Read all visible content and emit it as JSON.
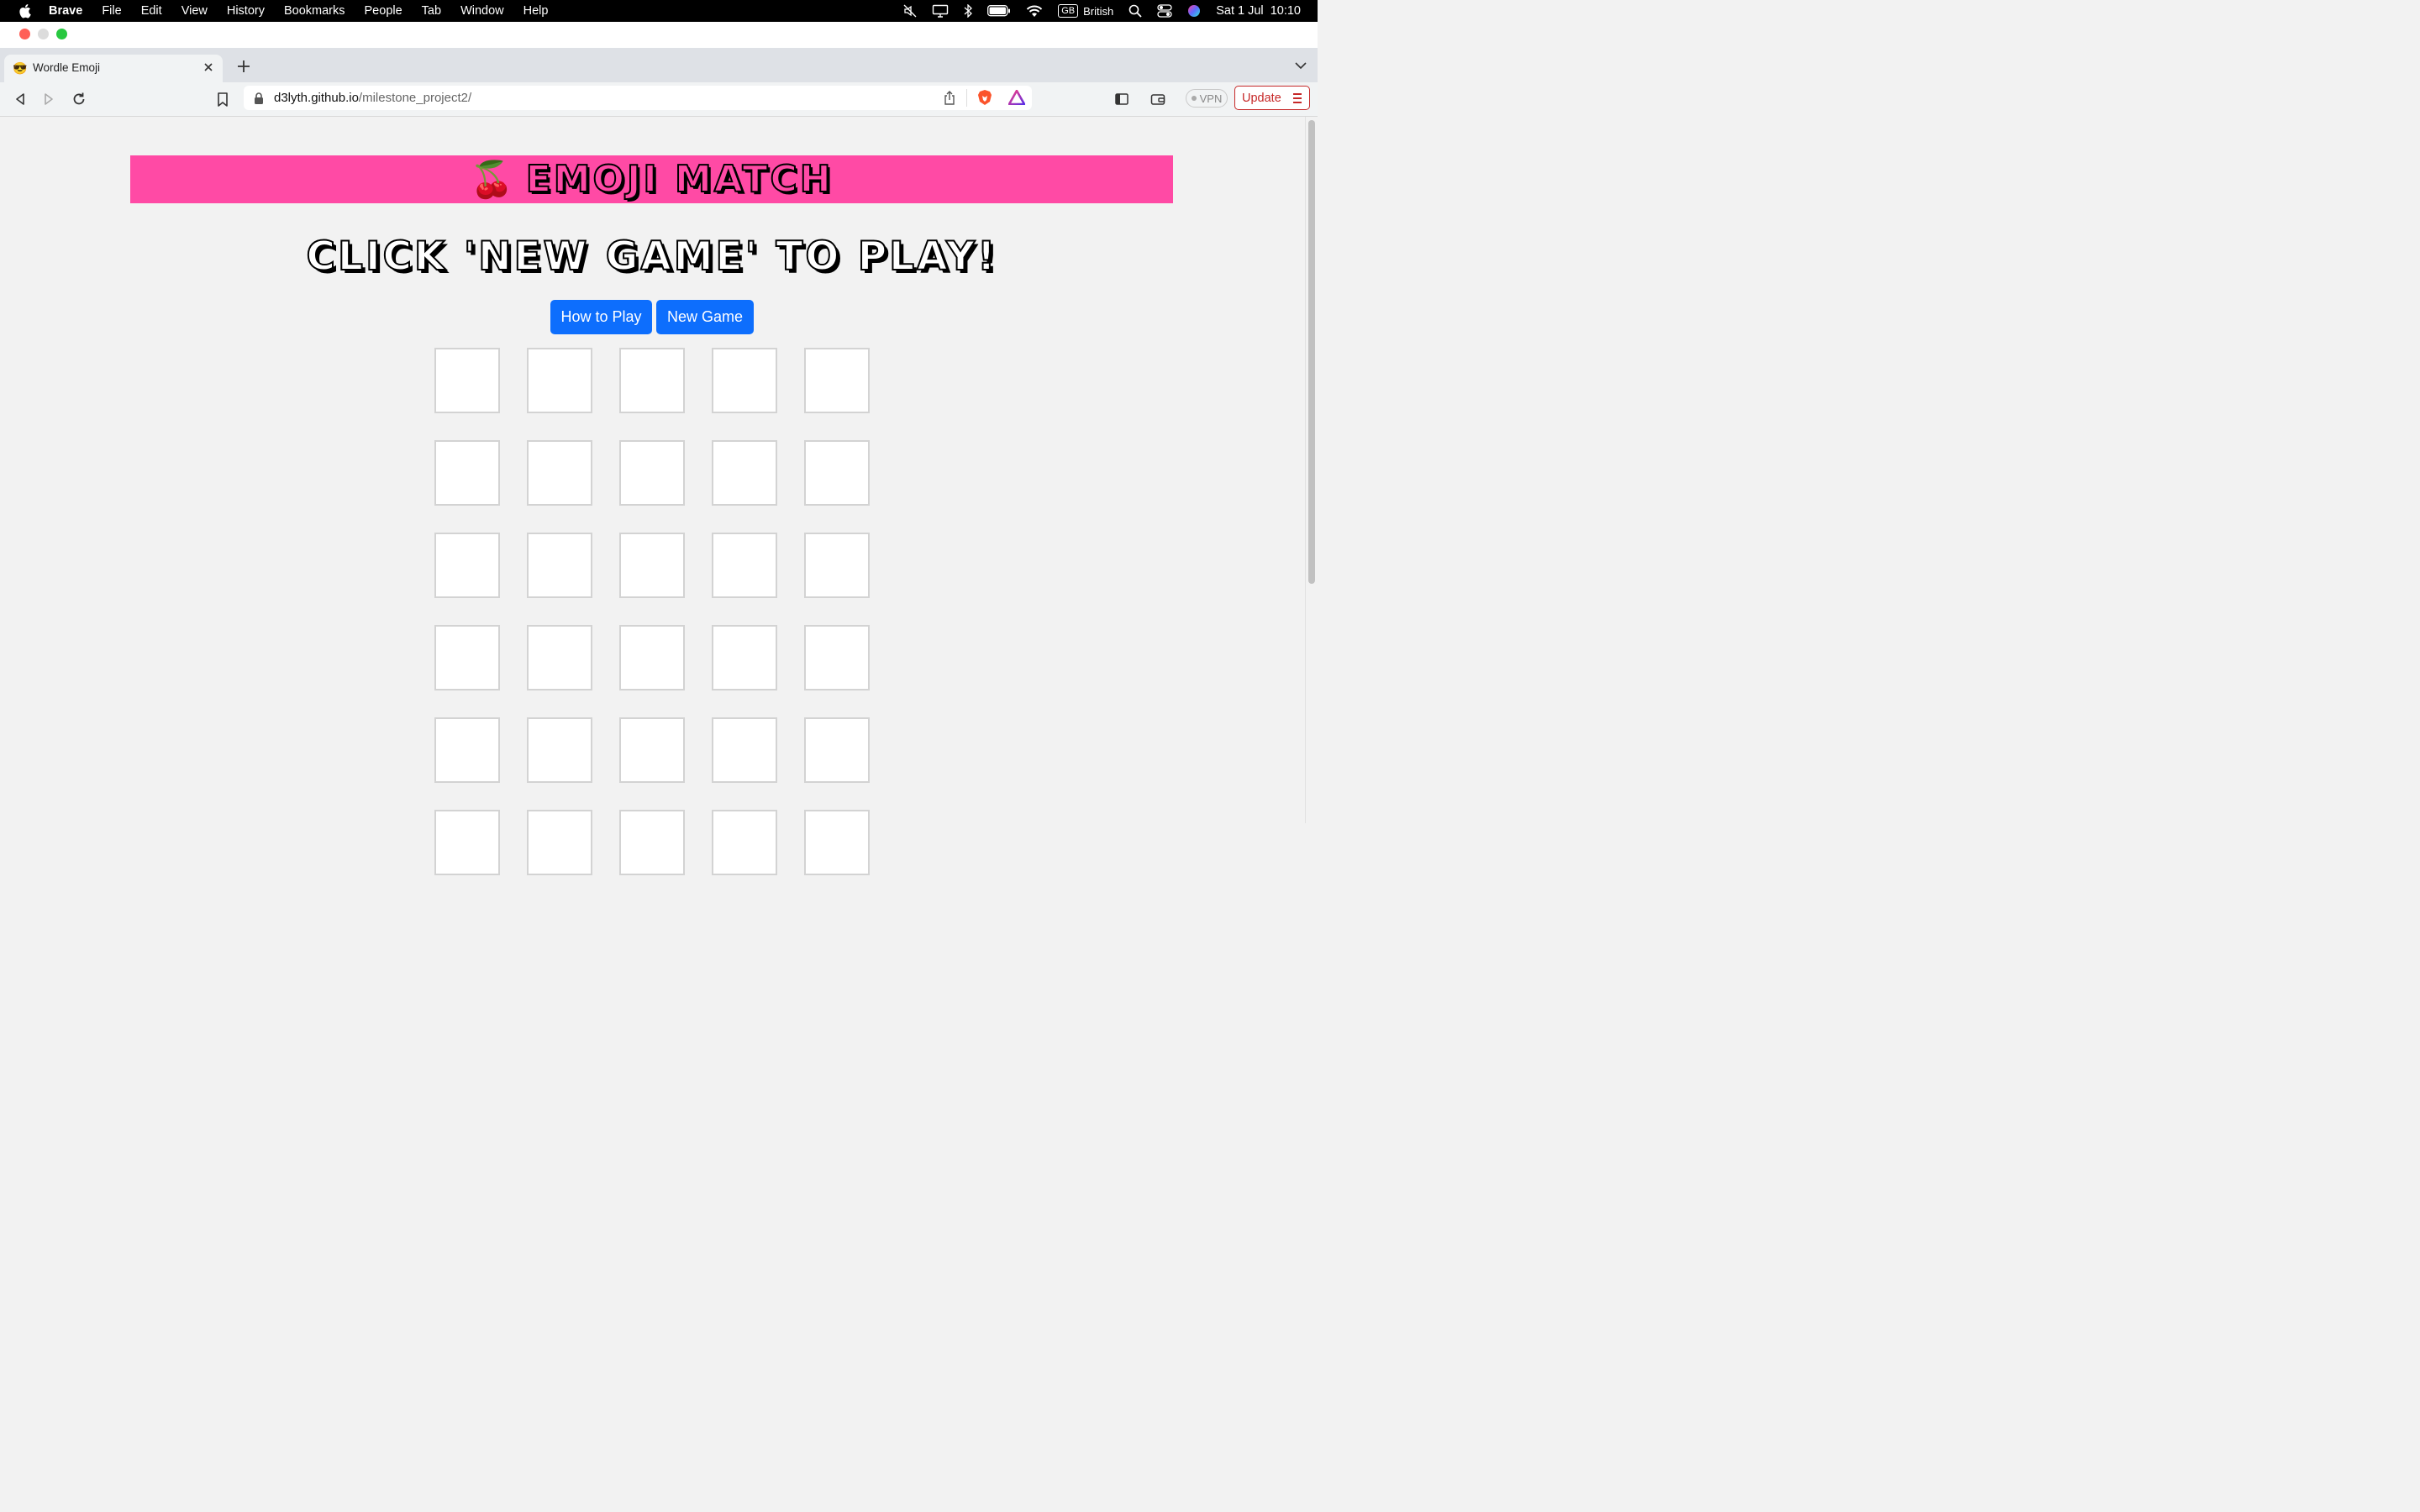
{
  "menubar": {
    "app_name": "Brave",
    "items": [
      "File",
      "Edit",
      "View",
      "History",
      "Bookmarks",
      "People",
      "Tab",
      "Window",
      "Help"
    ],
    "input_source_badge": "GB",
    "input_source_label": "British",
    "clock": "Sat 1 Jul  10:10"
  },
  "window": {
    "traffic_lights": {
      "close": "#ff5f57",
      "minimize": "#dcdcdc",
      "zoom": "#28c840"
    }
  },
  "tab": {
    "favicon": "😎",
    "title": "Wordle Emoji"
  },
  "toolbar": {
    "url_host": "d3lyth.github.io",
    "url_path": "/milestone_project2/",
    "vpn_label": "VPN",
    "update_label": "Update"
  },
  "page": {
    "banner": {
      "emoji": "🍒",
      "title": "EMOJI MATCH",
      "background": "#ff4aa5"
    },
    "heading": "CLICK 'NEW GAME' TO PLAY!",
    "buttons": {
      "how_to_play": "How to Play",
      "new_game": "New Game",
      "color": "#0d6efd"
    },
    "board": {
      "columns": 5,
      "visible_rows": 6
    }
  }
}
